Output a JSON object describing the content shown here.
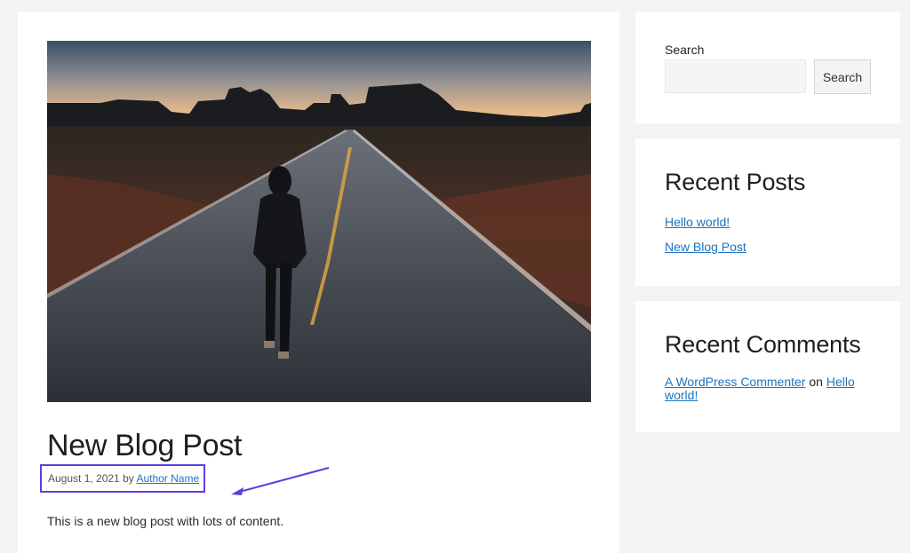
{
  "article": {
    "title": "New Blog Post",
    "meta": {
      "date": "August 1, 2021",
      "by": "by",
      "author": "Author Name"
    },
    "excerpt": "This is a new blog post with lots of content."
  },
  "sidebar": {
    "search": {
      "label": "Search",
      "placeholder": "",
      "button": "Search"
    },
    "recent_posts": {
      "title": "Recent Posts",
      "items": [
        "Hello world!",
        "New Blog Post"
      ]
    },
    "recent_comments": {
      "title": "Recent Comments",
      "commenter": "A WordPress Commenter",
      "on": "on",
      "post": "Hello world!"
    }
  },
  "colors": {
    "page_background": "#f1f3f5",
    "link": "#1e73be",
    "highlight": "#5b3fe0"
  }
}
